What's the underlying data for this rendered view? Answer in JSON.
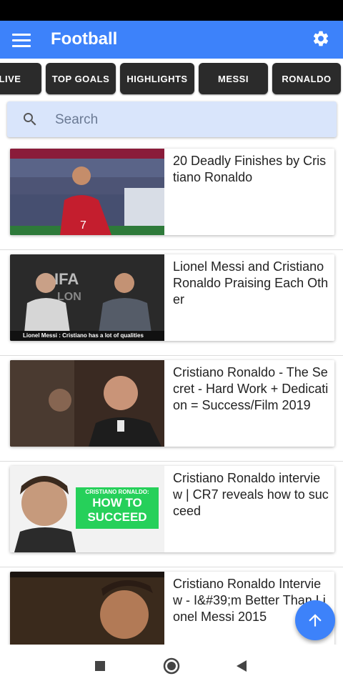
{
  "app_bar": {
    "title": "Football"
  },
  "chips": [
    "LIVE",
    "TOP GOALS",
    "HIGHLIGHTS",
    "MESSI",
    "RONALDO"
  ],
  "search": {
    "placeholder": "Search"
  },
  "videos": [
    {
      "title": "20 Deadly Finishes by Cristiano Ronaldo"
    },
    {
      "title": "Lionel Messi and Cristiano Ronaldo Praising Each Other",
      "caption": "Lionel Messi : Cristiano has a lot of qualities"
    },
    {
      "title": "Cristiano Ronaldo - The Secret - Hard Work + Dedication = Success/Film 2019"
    },
    {
      "title": "Cristiano Ronaldo interview | CR7 reveals how to succeed",
      "overlay_top": "CRISTIANO RONALDO:",
      "overlay_line1": "HOW TO",
      "overlay_line2": "SUCCEED"
    },
    {
      "title": "Cristiano Ronaldo Interview - I&#39;m Better Than Lionel Messi 2015"
    }
  ],
  "colors": {
    "primary": "#3d82fa",
    "chip_bg": "#2b2b2b",
    "search_bg": "#d9e5fb"
  },
  "icons": {
    "menu": "menu-icon",
    "settings": "gear-icon",
    "search": "search-icon",
    "fab": "arrow-up-icon"
  }
}
